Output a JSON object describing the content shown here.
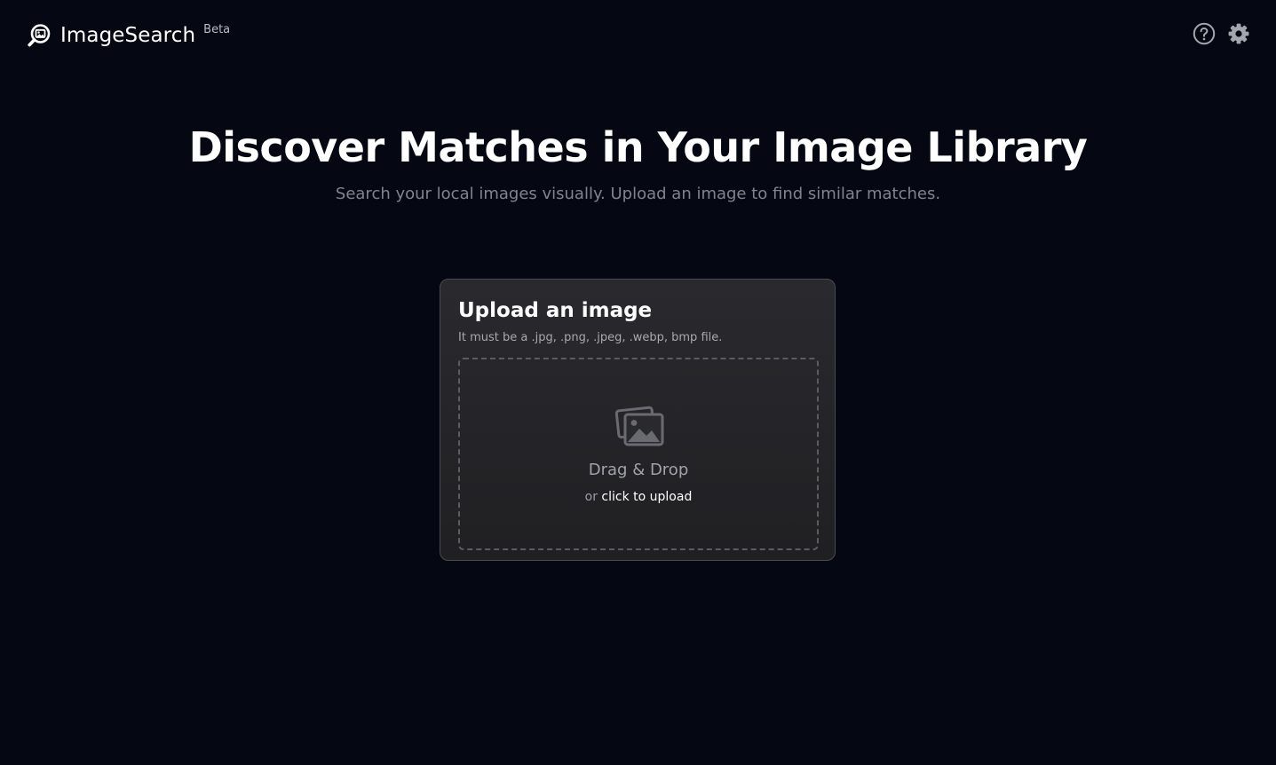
{
  "header": {
    "brand_name": "ImageSearch",
    "badge": "Beta",
    "logo_icon": "magnifier-image-icon",
    "actions": {
      "help_icon": "help-circle-icon",
      "settings_icon": "gear-icon"
    }
  },
  "hero": {
    "title": "Discover Matches in Your Image Library",
    "subtitle": "Search your local images visually. Upload an image to find similar matches."
  },
  "upload": {
    "title": "Upload an image",
    "hint": "It must be a .jpg, .png, .jpeg, .webp, bmp file.",
    "dropzone": {
      "icon": "images-icon",
      "title": "Drag & Drop",
      "sub_prefix": "or",
      "sub_link": "click to upload"
    }
  },
  "colors": {
    "background": "#050812",
    "card_background": "#26262a",
    "card_border": "#4a4a4f",
    "muted_text": "#80848f"
  }
}
